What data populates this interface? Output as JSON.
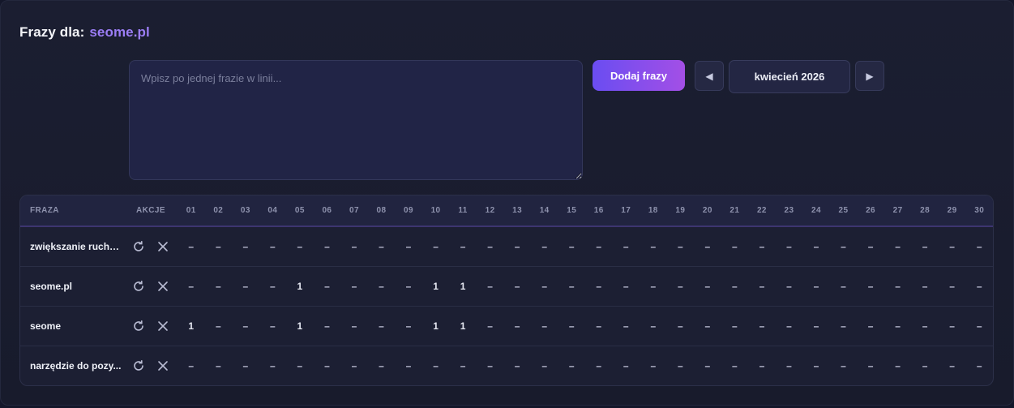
{
  "header": {
    "title_label": "Frazy dla:",
    "domain": "seome.pl"
  },
  "input": {
    "placeholder": "Wpisz po jednej frazie w linii..."
  },
  "controls": {
    "add_label": "Dodaj frazy",
    "prev_glyph": "◀",
    "next_glyph": "▶",
    "month": "kwiecień 2026"
  },
  "table": {
    "col_phrase": "FRAZA",
    "col_actions": "AKCJE",
    "days": [
      "01",
      "02",
      "03",
      "04",
      "05",
      "06",
      "07",
      "08",
      "09",
      "10",
      "11",
      "12",
      "13",
      "14",
      "15",
      "16",
      "17",
      "18",
      "19",
      "20",
      "21",
      "22",
      "23",
      "24",
      "25",
      "26",
      "27",
      "28",
      "29",
      "30"
    ],
    "rows": [
      {
        "phrase": "zwiększanie ruchu ...",
        "positions": [
          "–",
          "–",
          "–",
          "–",
          "–",
          "–",
          "–",
          "–",
          "–",
          "–",
          "–",
          "–",
          "–",
          "–",
          "–",
          "–",
          "–",
          "–",
          "–",
          "–",
          "–",
          "–",
          "–",
          "–",
          "–",
          "–",
          "–",
          "–",
          "–",
          "–"
        ]
      },
      {
        "phrase": "seome.pl",
        "positions": [
          "–",
          "–",
          "–",
          "–",
          "1",
          "–",
          "–",
          "–",
          "–",
          "1",
          "1",
          "–",
          "–",
          "–",
          "–",
          "–",
          "–",
          "–",
          "–",
          "–",
          "–",
          "–",
          "–",
          "–",
          "–",
          "–",
          "–",
          "–",
          "–",
          "–"
        ]
      },
      {
        "phrase": "seome",
        "positions": [
          "1",
          "–",
          "–",
          "–",
          "1",
          "–",
          "–",
          "–",
          "–",
          "1",
          "1",
          "–",
          "–",
          "–",
          "–",
          "–",
          "–",
          "–",
          "–",
          "–",
          "–",
          "–",
          "–",
          "–",
          "–",
          "–",
          "–",
          "–",
          "–",
          "–"
        ]
      },
      {
        "phrase": "narzędzie do pozy...",
        "positions": [
          "–",
          "–",
          "–",
          "–",
          "–",
          "–",
          "–",
          "–",
          "–",
          "–",
          "–",
          "–",
          "–",
          "–",
          "–",
          "–",
          "–",
          "–",
          "–",
          "–",
          "–",
          "–",
          "–",
          "–",
          "–",
          "–",
          "–",
          "–",
          "–",
          "–"
        ]
      }
    ]
  },
  "icons": {
    "refresh": "refresh-icon",
    "delete": "close-icon"
  },
  "colors": {
    "accent": "#9b7df5",
    "button_gradient_start": "#6a4df1",
    "button_gradient_end": "#a34fe6",
    "background": "#1b1e31"
  }
}
